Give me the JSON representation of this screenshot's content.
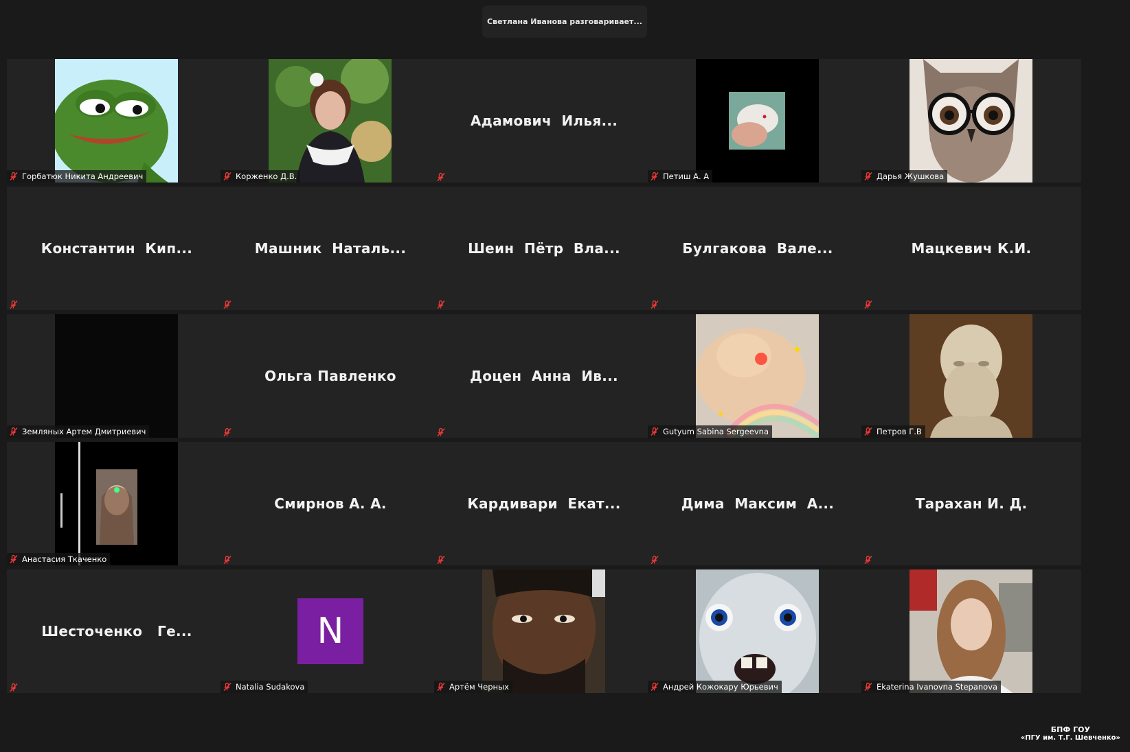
{
  "header": {
    "speaker_status": "Светлана Иванова разговаривает..."
  },
  "tiles": [
    {
      "name": "Горбатюк Никита Андреевич",
      "photo": "pepe-frog"
    },
    {
      "name": "Корженко Д.В.",
      "photo": "girl-school"
    },
    {
      "name": "Адамович  Илья..."
    },
    {
      "name": "Петиш А. А",
      "photo": "hamster-dark"
    },
    {
      "name": "Дарья Жушкова",
      "photo": "owl-glasses"
    },
    {
      "name": "Константин  Кип..."
    },
    {
      "name": "Машник  Наталь..."
    },
    {
      "name": "Шеин  Пётр  Вла..."
    },
    {
      "name": "Булгакова  Вале..."
    },
    {
      "name": "Мацкевич К.И."
    },
    {
      "name": "Земляных Артем Дмитриевич",
      "photo": "black"
    },
    {
      "name": "Ольга Павленко"
    },
    {
      "name": "Доцен  Анна  Ив..."
    },
    {
      "name": "Gutyum Sabina Sergeevna",
      "photo": "cat-rainbow"
    },
    {
      "name": "Петров Г.В",
      "photo": "bust-statue"
    },
    {
      "name": "Анастасия Ткаченко",
      "photo": "video-dark-girl"
    },
    {
      "name": "Смирнов А. А."
    },
    {
      "name": "Кардивари  Екат..."
    },
    {
      "name": "Дима  Максим  А..."
    },
    {
      "name": "Тарахан И. Д."
    },
    {
      "name": "Шесточенко   Ге..."
    },
    {
      "name": "Natalia Sudakova",
      "initial": "N",
      "initial_color": "#7b1fa2"
    },
    {
      "name": "Артём Черных",
      "photo": "cartoon-man"
    },
    {
      "name": "Андрей Кожокару Юрьевич",
      "photo": "rabbid"
    },
    {
      "name": "Ekaterina Ivanovna Stepanova",
      "photo": "girl-selfie"
    }
  ],
  "watermark": {
    "line1": "БПФ ГОУ",
    "line2": "«ПГУ им. Т.Г. Шевченко»"
  },
  "colors": {
    "background": "#1a1a1a",
    "tile": "#232323",
    "mute": "#e53935"
  }
}
